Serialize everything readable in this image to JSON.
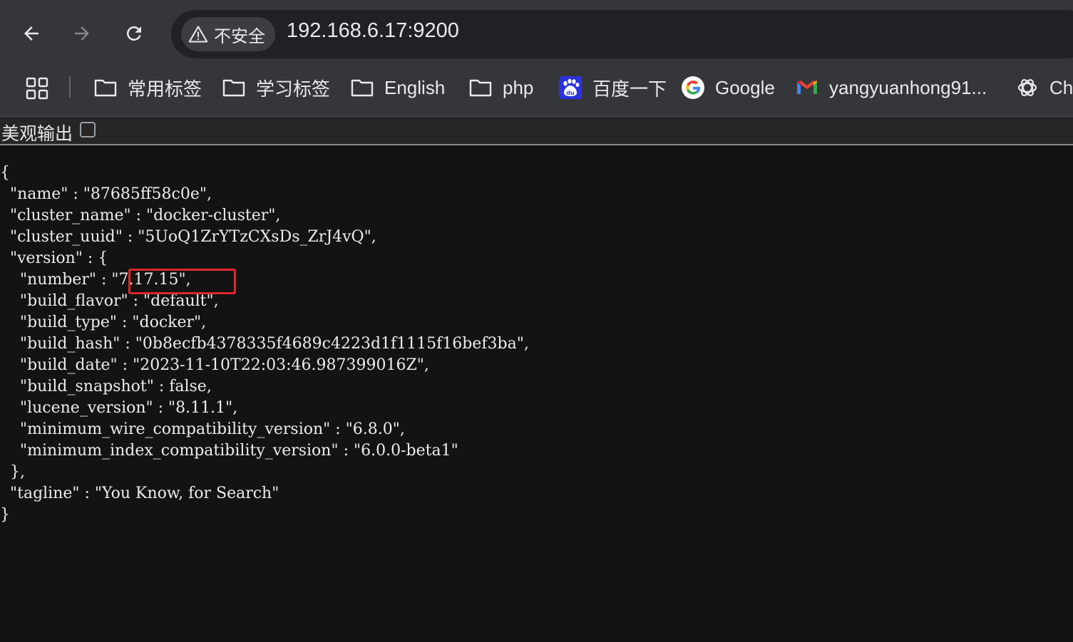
{
  "browser": {
    "security_chip": "不安全",
    "url": "192.168.6.17:9200",
    "bookmarks": [
      {
        "label": "常用标签",
        "icon": "folder-icon"
      },
      {
        "label": "学习标签",
        "icon": "folder-icon"
      },
      {
        "label": "English",
        "icon": "folder-icon"
      },
      {
        "label": "php",
        "icon": "folder-icon"
      },
      {
        "label": "百度一下",
        "icon": "baidu-icon"
      },
      {
        "label": "Google",
        "icon": "google-icon"
      },
      {
        "label": "yangyuanhong91...",
        "icon": "gmail-icon"
      },
      {
        "label": "Cha",
        "icon": "openai-icon"
      }
    ]
  },
  "page": {
    "pretty_label": "美观输出",
    "pretty_checked": false,
    "json_lines": [
      "{",
      "  \"name\" : \"87685ff58c0e\",",
      "  \"cluster_name\" : \"docker-cluster\",",
      "  \"cluster_uuid\" : \"5UoQ1ZrYTzCXsDs_ZrJ4vQ\",",
      "  \"version\" : {",
      "    \"number\" : \"7.17.15\",",
      "    \"build_flavor\" : \"default\",",
      "    \"build_type\" : \"docker\",",
      "    \"build_hash\" : \"0b8ecfb4378335f4689c4223d1f1115f16bef3ba\",",
      "    \"build_date\" : \"2023-11-10T22:03:46.987399016Z\",",
      "    \"build_snapshot\" : false,",
      "    \"lucene_version\" : \"8.11.1\",",
      "    \"minimum_wire_compatibility_version\" : \"6.8.0\",",
      "    \"minimum_index_compatibility_version\" : \"6.0.0-beta1\"",
      "  },",
      "  \"tagline\" : \"You Know, for Search\"",
      "}"
    ]
  },
  "colors": {
    "toolbar_bg": "#35363a",
    "omnibox_bg": "#202124",
    "page_bg": "#131313",
    "highlight": "#e0262b"
  }
}
